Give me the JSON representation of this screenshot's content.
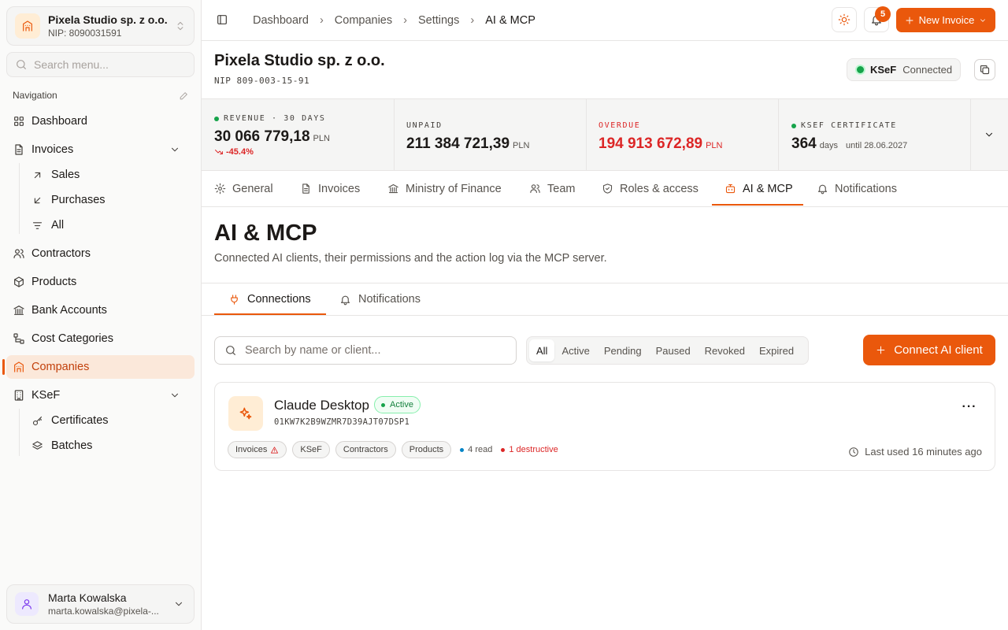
{
  "org": {
    "name": "Pixela Studio sp. z o.o.",
    "nip": "NIP: 8090031591"
  },
  "sidebar_search": {
    "placeholder": "Search menu..."
  },
  "nav": {
    "heading": "Navigation",
    "dashboard": "Dashboard",
    "invoices": "Invoices",
    "invoices_sub": {
      "sales": "Sales",
      "purchases": "Purchases",
      "all": "All"
    },
    "contractors": "Contractors",
    "products": "Products",
    "bank_accounts": "Bank Accounts",
    "cost_categories": "Cost Categories",
    "companies": "Companies",
    "ksef": "KSeF",
    "ksef_sub": {
      "certificates": "Certificates",
      "batches": "Batches"
    }
  },
  "user": {
    "name": "Marta Kowalska",
    "email": "marta.kowalska@pixela-..."
  },
  "breadcrumbs": [
    "Dashboard",
    "Companies",
    "Settings",
    "AI & MCP"
  ],
  "topbar": {
    "notification_count": "5",
    "new_invoice": "New Invoice"
  },
  "company": {
    "title": "Pixela Studio sp. z o.o.",
    "nip": "NIP 809-003-15-91",
    "ksef_label": "KSeF",
    "ksef_status": "Connected"
  },
  "stats": {
    "revenue": {
      "label": "REVENUE · 30 DAYS",
      "value": "30 066 779,18",
      "currency": "PLN",
      "change": "-45.4%"
    },
    "unpaid": {
      "label": "UNPAID",
      "value": "211 384 721,39",
      "currency": "PLN"
    },
    "overdue": {
      "label": "OVERDUE",
      "value": "194 913 672,89",
      "currency": "PLN"
    },
    "certificate": {
      "label": "KSEF CERTIFICATE",
      "value": "364",
      "unit": "days",
      "until": "until 28.06.2027"
    }
  },
  "tabs": {
    "general": "General",
    "invoices": "Invoices",
    "ministry": "Ministry of Finance",
    "team": "Team",
    "roles": "Roles & access",
    "ai_mcp": "AI & MCP",
    "notifications": "Notifications"
  },
  "page": {
    "title": "AI & MCP",
    "subtitle": "Connected AI clients, their permissions and the action log via the MCP server."
  },
  "sub_tabs": {
    "connections": "Connections",
    "notifications": "Notifications"
  },
  "filter": {
    "search_placeholder": "Search by name or client...",
    "options": [
      "All",
      "Active",
      "Pending",
      "Paused",
      "Revoked",
      "Expired"
    ],
    "selected": "All",
    "connect_button": "Connect AI client"
  },
  "connection": {
    "name": "Claude Desktop",
    "status": "Active",
    "id": "01KW7K2B9WZMR7D39AJT07DSP1",
    "scopes": [
      "Invoices",
      "KSeF",
      "Contractors",
      "Products"
    ],
    "read_count": "4 read",
    "destructive_count": "1 destructive",
    "last_used": "Last used 16 minutes ago"
  },
  "colors": {
    "accent": "#ea580c",
    "danger": "#dc2626",
    "success": "#16a34a"
  }
}
